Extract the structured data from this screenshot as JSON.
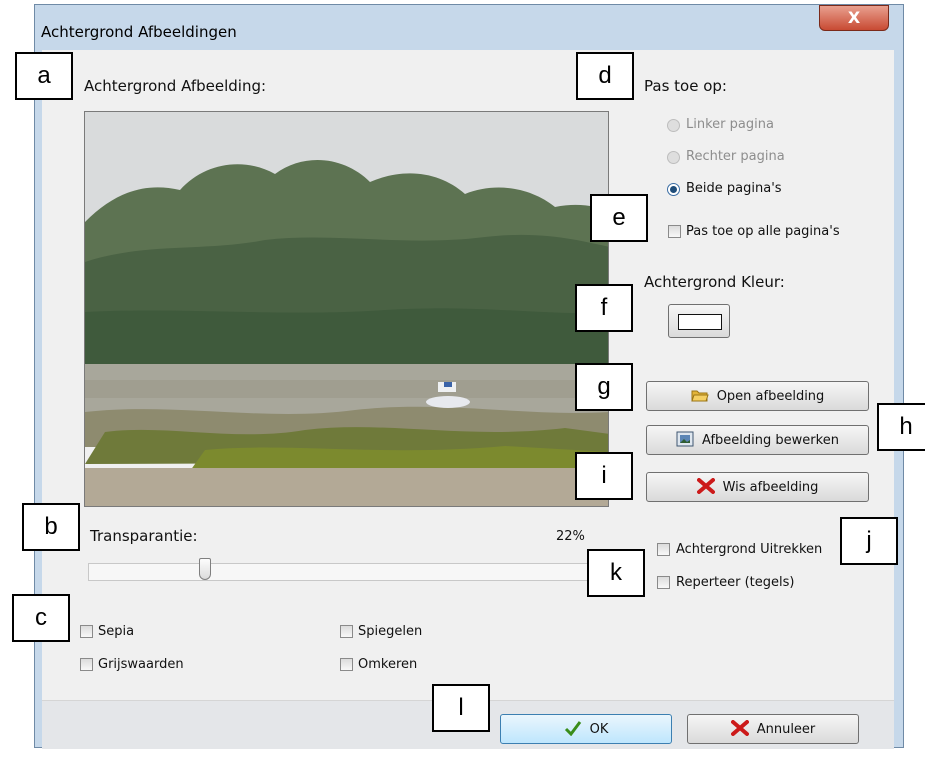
{
  "window": {
    "title": "Achtergrond Afbeeldingen",
    "close_glyph": "X"
  },
  "image_section": {
    "label": "Achtergrond Afbeelding:"
  },
  "apply_section": {
    "label": "Pas toe op:",
    "options": [
      {
        "label": "Linker pagina",
        "state": "disabled"
      },
      {
        "label": "Rechter pagina",
        "state": "disabled"
      },
      {
        "label": "Beide pagina's",
        "state": "selected"
      }
    ],
    "apply_all_label": "Pas toe op alle pagina's"
  },
  "background_color": {
    "label": "Achtergrond Kleur:",
    "value": "#ffffff"
  },
  "buttons": {
    "open": "Open afbeelding",
    "edit": "Afbeelding bewerken",
    "clear": "Wis afbeelding",
    "ok": "OK",
    "cancel": "Annuleer"
  },
  "transparency": {
    "label": "Transparantie:",
    "value_text": "22%",
    "value": 0.22
  },
  "options_checkboxes": {
    "sepia": "Sepia",
    "grayscale": "Grijswaarden",
    "mirror": "Spiegelen",
    "invert": "Omkeren",
    "stretch": "Achtergrond Uitrekken",
    "repeat": "Reperteer (tegels)"
  },
  "callouts": [
    "a",
    "b",
    "c",
    "d",
    "e",
    "f",
    "g",
    "h",
    "i",
    "j",
    "k",
    "l"
  ],
  "icons": {
    "open": "folder-icon",
    "edit": "picture-icon",
    "clear": "red-x-icon",
    "ok": "checkmark-icon",
    "cancel": "red-x-icon"
  },
  "colors": {
    "accent_red": "#cc1a1a",
    "check_green": "#3a8d1a",
    "folder_yellow": "#e2b43a"
  }
}
